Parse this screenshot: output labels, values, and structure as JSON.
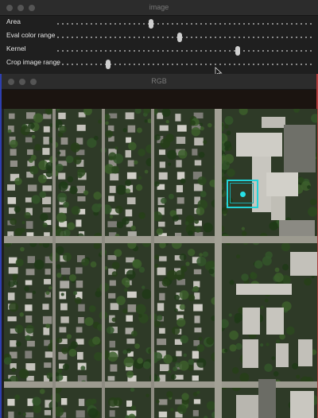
{
  "image_window": {
    "title": "image",
    "sliders": [
      {
        "label": "Area",
        "value": 0.37
      },
      {
        "label": "Eval color range",
        "value": 0.48
      },
      {
        "label": "Kernel",
        "value": 0.71
      },
      {
        "label": "Crop image range",
        "value": 0.2
      }
    ]
  },
  "rgb_window": {
    "title": "RGB"
  },
  "colors": {
    "roi": "#22d3d8",
    "window_bg": "#1f1f1f"
  }
}
